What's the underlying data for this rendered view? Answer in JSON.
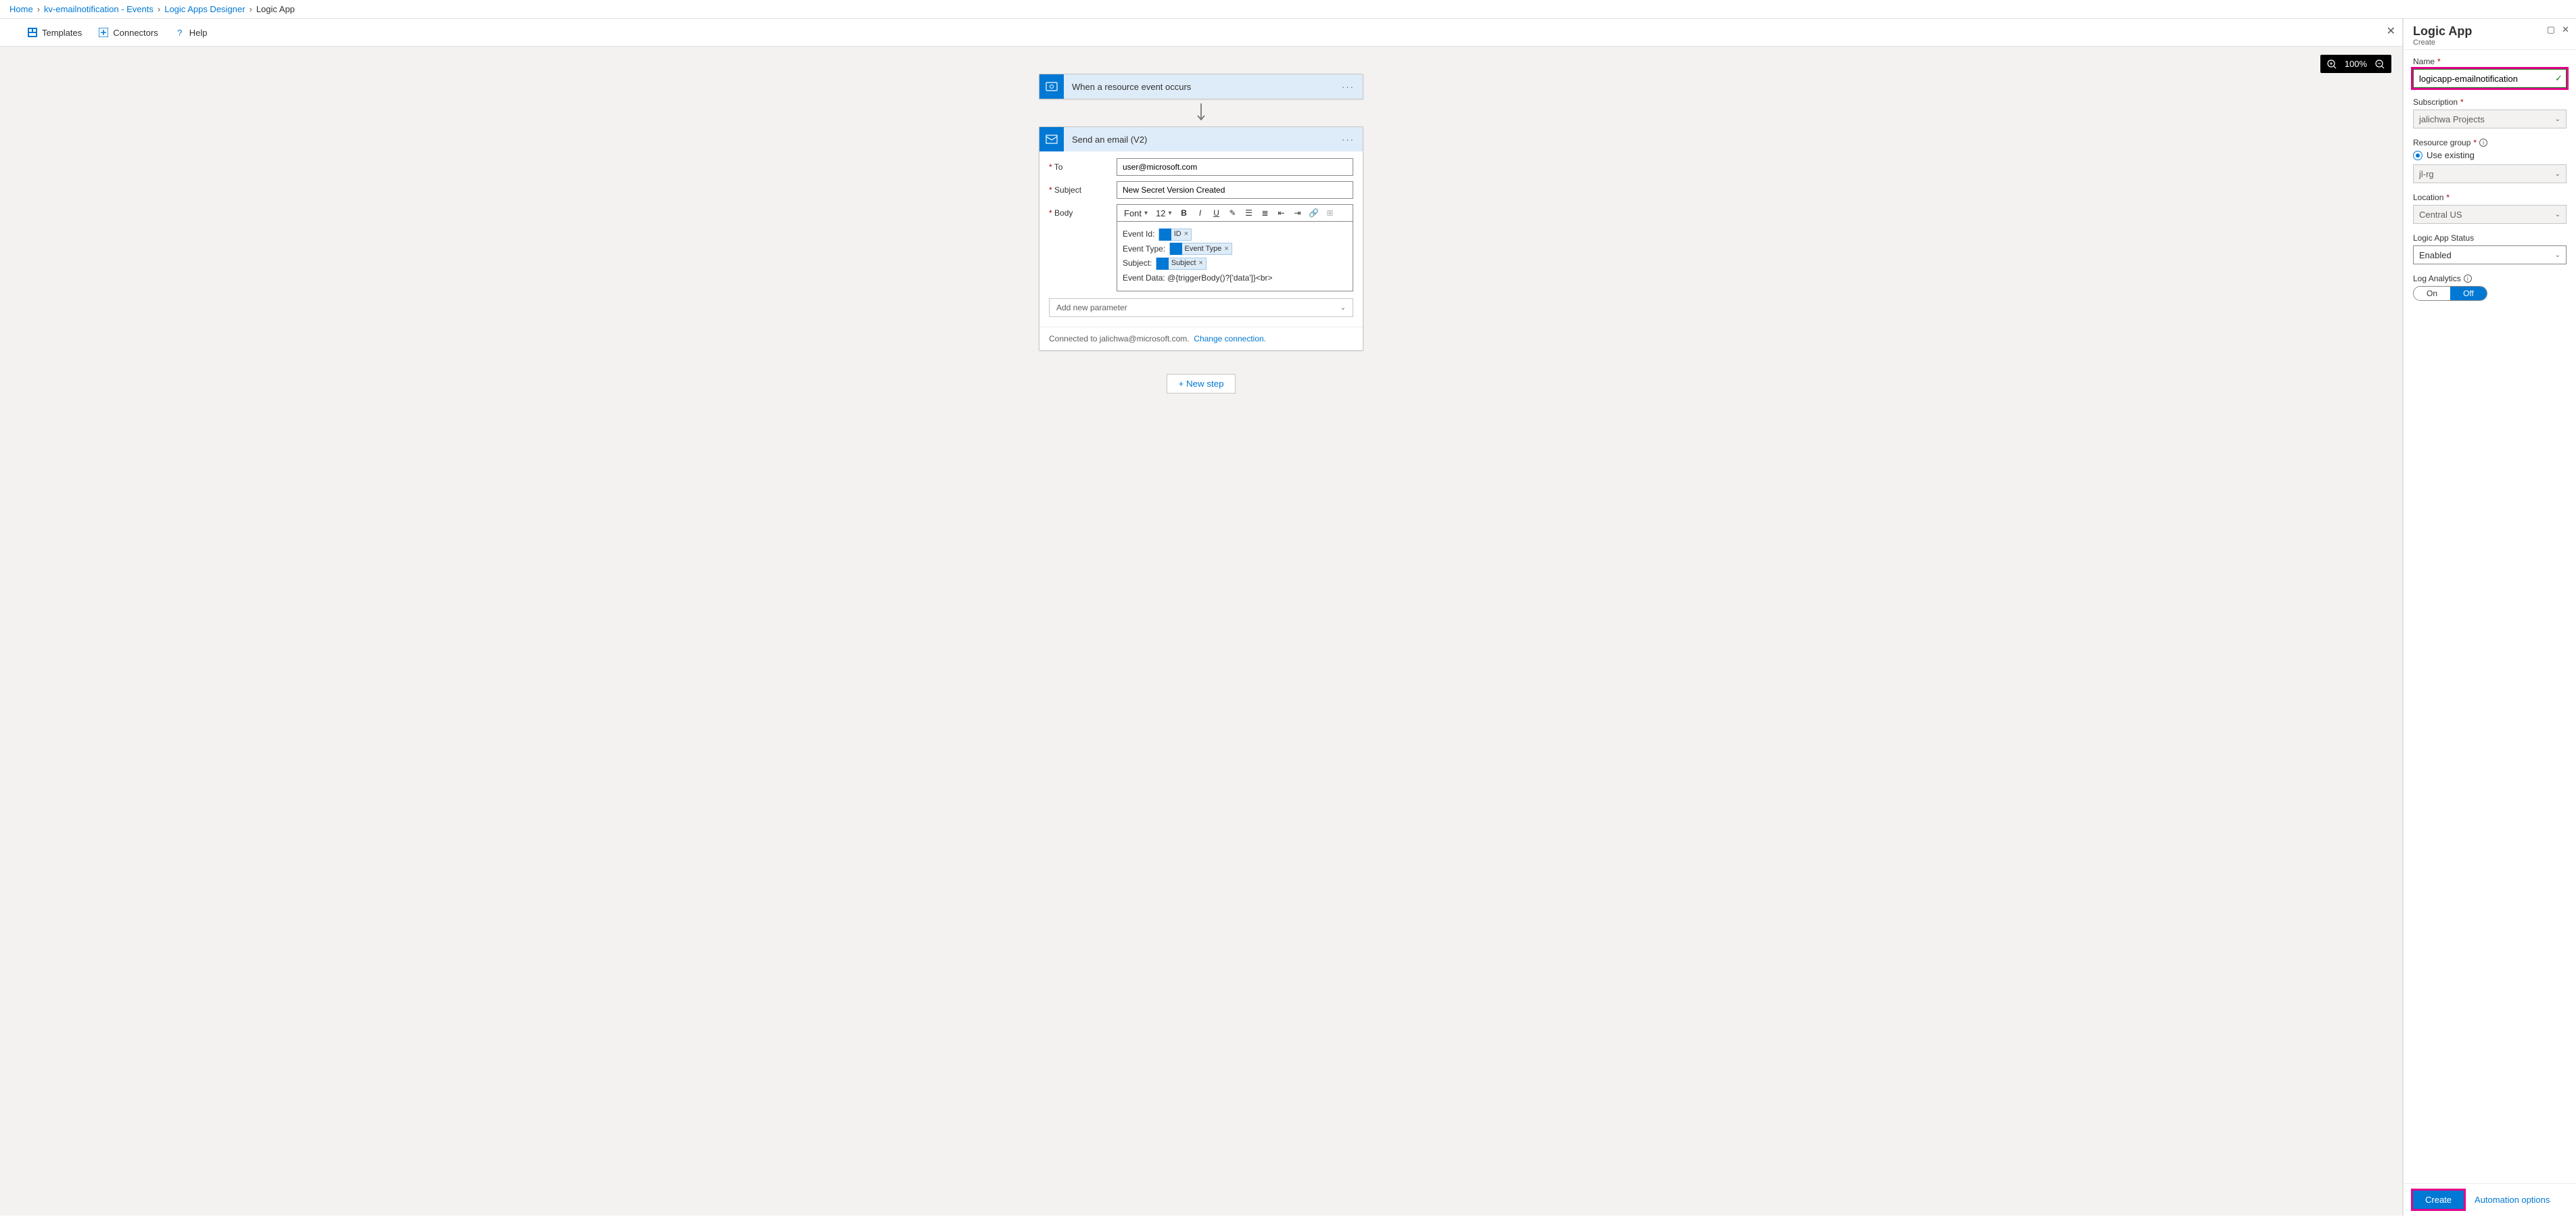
{
  "breadcrumb": {
    "home": "Home",
    "kv": "kv-emailnotification - Events",
    "designer": "Logic Apps Designer",
    "current": "Logic App"
  },
  "toolbar": {
    "templates": "Templates",
    "connectors": "Connectors",
    "help": "Help"
  },
  "zoom": {
    "level": "100%"
  },
  "trigger": {
    "title": "When a resource event occurs"
  },
  "email": {
    "title": "Send an email (V2)",
    "to_label": "To",
    "to_value": "user@microsoft.com",
    "subject_label": "Subject",
    "subject_value": "New Secret Version Created",
    "body_label": "Body",
    "font_label": "Font",
    "font_size": "12",
    "body_lines": {
      "l1": "Event Id:",
      "l2": "Event Type:",
      "l3": "Subject:",
      "l4": "Event Data: @{triggerBody()?['data']}<br>"
    },
    "tokens": {
      "id": "ID",
      "event_type": "Event Type",
      "subject": "Subject"
    },
    "add_param": "Add new parameter",
    "connected": "Connected to jalichwa@microsoft.com.",
    "change": "Change connection."
  },
  "new_step": "+ New step",
  "panel": {
    "title": "Logic App",
    "subtitle": "Create",
    "name_label": "Name",
    "name_value": "logicapp-emailnotification",
    "sub_label": "Subscription",
    "sub_value": "jalichwa Projects",
    "rg_label": "Resource group",
    "rg_radio": "Use existing",
    "rg_value": "jl-rg",
    "loc_label": "Location",
    "loc_value": "Central US",
    "status_label": "Logic App Status",
    "status_value": "Enabled",
    "log_label": "Log Analytics",
    "toggle_on": "On",
    "toggle_off": "Off",
    "create": "Create",
    "automation": "Automation options"
  }
}
